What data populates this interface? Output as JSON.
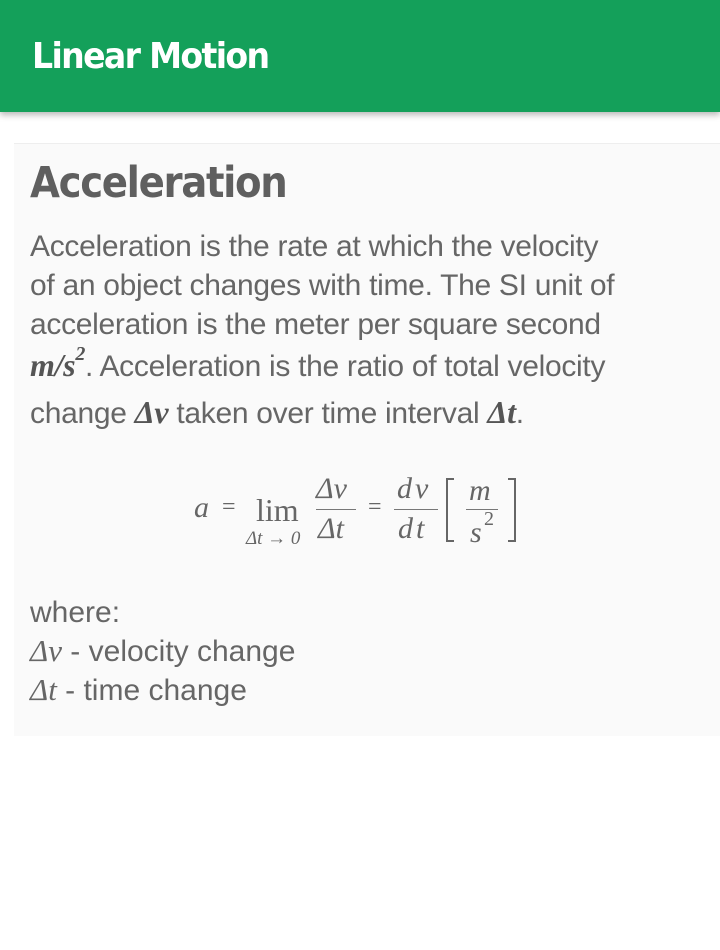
{
  "app_bar": {
    "title": "Linear Motion"
  },
  "content": {
    "title": "Acceleration",
    "paragraph": {
      "line1": "Acceleration is the rate at which the velocity",
      "line2": "of an object changes with time. The SI unit of",
      "line3": "acceleration is the meter per square second",
      "unit_m": "m/s",
      "unit_exp": "2",
      "line4_rest": ". Acceleration is the ratio of total velocity",
      "line5_pre": "change ",
      "dv": "Δv",
      "line5_mid": " taken over time interval ",
      "dt": "Δt",
      "line5_end": "."
    },
    "formula": {
      "a": "a",
      "eq1": "=",
      "lim": "lim",
      "lim_sub": "Δt → 0",
      "num1": "Δv",
      "den1": "Δt",
      "eq2": "=",
      "num2": "dv",
      "den2": "dt",
      "unit_num": "m",
      "unit_den": "s",
      "unit_den_exp": "2"
    },
    "where": {
      "label": "where:",
      "items": [
        {
          "symbol": "Δv",
          "text": " - velocity change"
        },
        {
          "symbol": "Δt",
          "text": " - time change"
        }
      ]
    }
  }
}
